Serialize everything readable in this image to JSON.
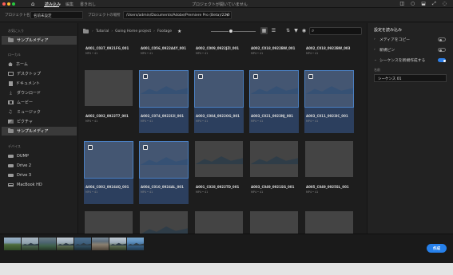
{
  "titlebar": {
    "tabs": [
      "読み込み",
      "編集",
      "書き出し"
    ],
    "active_tab": "読み込み",
    "center_text": "プロジェクトが開いていません",
    "icons": [
      "home-icon",
      "gear-icon",
      "bell-icon",
      "fullscreen-icon",
      "circle-icon"
    ]
  },
  "project": {
    "name_label": "プロジェクト名",
    "name_value": "名前未設定",
    "location_label": "プロジェクトの場所",
    "location_value": "/Users/admin/Documents/Adobe/Premiere Pro (Beta)/22.0"
  },
  "sidebar": {
    "favorites_heading": "お気に入り",
    "favorites": [
      {
        "label": "サンプルメディア",
        "icon": "folder-icon",
        "selected": true
      }
    ],
    "local_heading": "ローカル",
    "local": [
      {
        "label": "ホーム",
        "icon": "home-icon"
      },
      {
        "label": "デスクトップ",
        "icon": "desktop-icon"
      },
      {
        "label": "ドキュメント",
        "icon": "document-icon"
      },
      {
        "label": "ダウンロード",
        "icon": "download-icon"
      },
      {
        "label": "ムービー",
        "icon": "film-icon"
      },
      {
        "label": "ミュージック",
        "icon": "music-icon"
      },
      {
        "label": "ピクチャ",
        "icon": "picture-icon"
      },
      {
        "label": "サンプルメディア",
        "icon": "folder-icon",
        "selected": true
      }
    ],
    "devices_heading": "デバイス",
    "devices": [
      {
        "label": "DUMP",
        "icon": "drive-icon"
      },
      {
        "label": "Drive 2",
        "icon": "drive-icon"
      },
      {
        "label": "Drive 3",
        "icon": "drive-icon"
      },
      {
        "label": "MacBook HD",
        "icon": "laptop-icon"
      }
    ]
  },
  "browser": {
    "breadcrumb": [
      "Tutorial",
      "Going Home project",
      "Footage"
    ],
    "search_placeholder": "",
    "thumbnail_size": 0.45,
    "view": "grid"
  },
  "tiles": [
    {
      "name": "A001_C037_0921FG_001",
      "meta": "MP4 • 41",
      "style": "sky2 mtn",
      "selected": false
    },
    {
      "name": "A001_C056_0922A4Y_001",
      "meta": "MP4 • 41",
      "style": "sky3 mtn",
      "selected": false
    },
    {
      "name": "A002_C009_0922JZI_001",
      "meta": "MP4 • 41",
      "style": "sky6 mtn",
      "selected": false
    },
    {
      "name": "A002_C018_0922BW_001",
      "meta": "MP4 • 41",
      "style": "sky8 mtn",
      "selected": false
    },
    {
      "name": "A002_C018_0922BW_003",
      "meta": "MP4 • 41",
      "style": "sky9 mtn",
      "selected": false
    },
    {
      "name": "A002_C002_0922T7_001",
      "meta": "MP4 • 41",
      "style": "sky1",
      "selected": false
    },
    {
      "name": "A002_C074_0922I2I_001",
      "meta": "MP4 • 41",
      "style": "sky6 mtn",
      "selected": true
    },
    {
      "name": "A003_C084_0922OG_001",
      "meta": "MP4 • 41",
      "style": "sky3",
      "selected": true
    },
    {
      "name": "A003_C021_0923NJ_001",
      "meta": "MP4 • 41",
      "style": "sky8 mtn",
      "selected": true
    },
    {
      "name": "A003_C011_0923IC_001",
      "meta": "MP4 • 41",
      "style": "sky4 mtn",
      "selected": true
    },
    {
      "name": "A004_C002_09244Q_001",
      "meta": "MP4 • 41",
      "style": "church",
      "selected": true
    },
    {
      "name": "A004_C010_0924AL_001",
      "meta": "MP4 • 41",
      "style": "sky6 mtn",
      "selected": true
    },
    {
      "name": "A001_C028_0922TD_001",
      "meta": "MP4 • 41",
      "style": "sky5 mtn",
      "selected": false
    },
    {
      "name": "A003_C049_0921SG_001",
      "meta": "MP4 • 41",
      "style": "sky2 mtn",
      "selected": false
    },
    {
      "name": "A005_C049_0925SL_001",
      "meta": "MP4 • 41",
      "style": "sky10",
      "selected": false
    },
    {
      "name": "",
      "meta": "",
      "style": "street",
      "selected": false
    },
    {
      "name": "",
      "meta": "",
      "style": "sky6 mtn",
      "selected": false
    },
    {
      "name": "",
      "meta": "",
      "style": "church",
      "selected": false
    },
    {
      "name": "",
      "meta": "",
      "style": "lake",
      "selected": false
    },
    {
      "name": "",
      "meta": "",
      "style": "lake",
      "selected": false
    }
  ],
  "import_settings": {
    "title": "設定を読み込み",
    "options": [
      {
        "label": "メディアをコピー",
        "on": false
      },
      {
        "label": "新規ビン",
        "on": false
      },
      {
        "label": "シーケンスを新規作成する",
        "on": true
      }
    ],
    "name_label": "名前",
    "sequence_name": "シーケンス 01"
  },
  "bottom": {
    "strip": [
      "sky1",
      "sky2 mtn",
      "sky3",
      "sky6 mtn",
      "sky4 mtn",
      "church",
      "sky6 mtn",
      "sky5 mtn"
    ],
    "create_label": "作成"
  }
}
